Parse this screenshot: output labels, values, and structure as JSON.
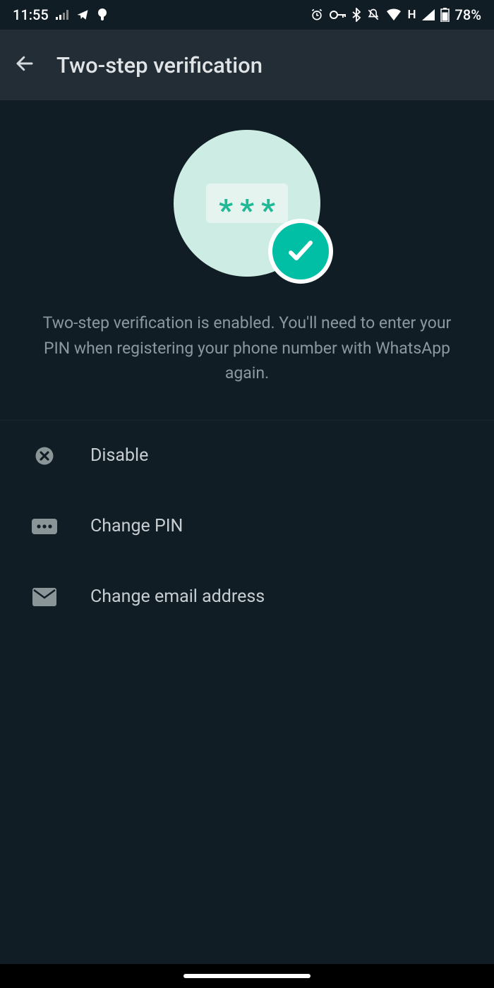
{
  "status_bar": {
    "time": "11:55",
    "battery_text": "78%",
    "network_text": "H"
  },
  "toolbar": {
    "title": "Two-step verification"
  },
  "hero": {
    "description": "Two-step verification is enabled. You'll need to enter your PIN when registering your phone number with WhatsApp again."
  },
  "options": [
    {
      "label": "Disable",
      "icon": "close-circle-icon"
    },
    {
      "label": "Change PIN",
      "icon": "pin-dots-icon"
    },
    {
      "label": "Change email address",
      "icon": "email-icon"
    }
  ]
}
